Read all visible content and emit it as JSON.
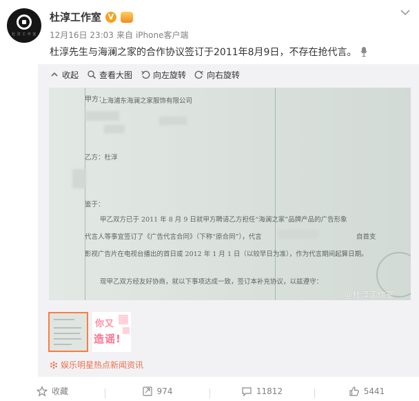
{
  "post": {
    "author": "杜淳工作室",
    "avatar_caption": "杜 淳 工 作 室",
    "time": "12月16日 23:03",
    "via_prefix": "来自",
    "via_source": "iPhone客户端",
    "text": "杜淳先生与海澜之家的合作协议签订于2011年8月9日，不存在抢代言。"
  },
  "toolbar": {
    "collapse": "收起",
    "view_large": "查看大图",
    "rotate_left": "向左旋转",
    "rotate_right": "向右旋转"
  },
  "document": {
    "party_a": "甲方：",
    "party_a_name": "上海浦东海澜之家服饰有限公司",
    "party_b": "乙方：杜淳",
    "whereas": "鉴于：",
    "para1": "甲乙双方已于 2011 年 8 月 9 日就甲方聘请乙方担任“海澜之家”品牌产品的广告形象",
    "para2a": "代言人等事宜签订了《广告代言合同》（下称“原合同”），代言",
    "para2b": "自首支",
    "para3": "影视广告片在电视台播出的首日或 2012 年 1 月 1 日（以较早日为准），作为代言期间起算日期。",
    "para4": "现甲乙双方经友好协商，就以下事项达成一致，签订本补充协议，以兹遵守：",
    "watermark": "@杜淳工作室"
  },
  "thumbnails": {
    "second_line1": "你又",
    "second_line2": "造谣!"
  },
  "source": {
    "label": "娱乐明星热点新闻资讯"
  },
  "actions": {
    "favorite": "收藏",
    "repost_count": "974",
    "comment_count": "11812",
    "like_count": "5441"
  },
  "colors": {
    "accent": "#eb7350",
    "verified": "#f6a21e",
    "thumb_border": "#fa7d3c"
  }
}
